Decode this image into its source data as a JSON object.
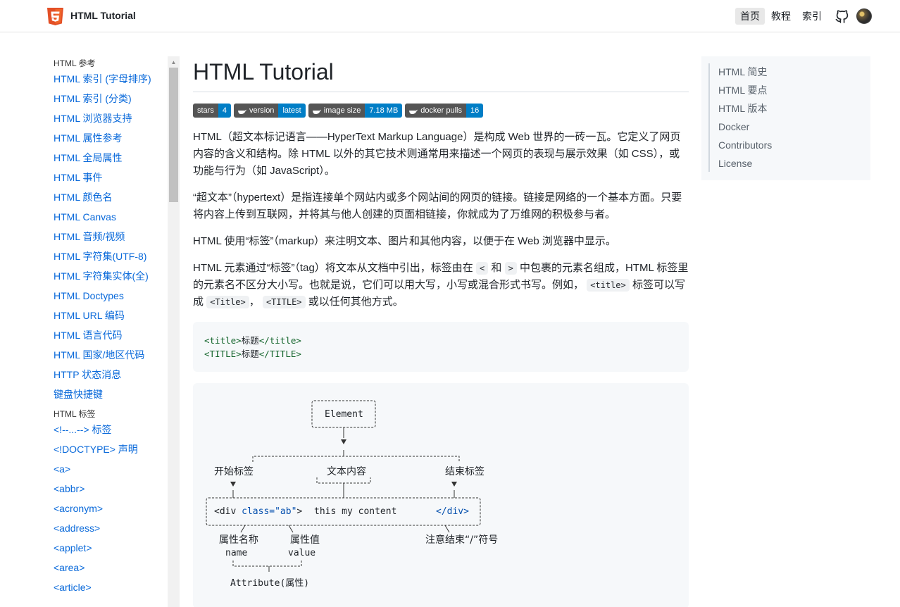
{
  "header": {
    "brand": "HTML Tutorial",
    "nav": [
      "首页",
      "教程",
      "索引"
    ]
  },
  "sidebar": {
    "group1": "HTML 参考",
    "items1": [
      "HTML 索引 (字母排序)",
      "HTML 索引 (分类)",
      "HTML 浏览器支持",
      "HTML 属性参考",
      "HTML 全局属性",
      "HTML 事件",
      "HTML 颜色名",
      "HTML Canvas",
      "HTML 音频/视频",
      "HTML 字符集(UTF-8)",
      "HTML 字符集实体(全)",
      "HTML Doctypes",
      "HTML URL 编码",
      "HTML 语言代码",
      "HTML 国家/地区代码",
      "HTTP 状态消息",
      "键盘快捷键"
    ],
    "group2": "HTML 标签",
    "items2": [
      "<!--...--> 标签",
      "<!DOCTYPE> 声明",
      "<a>",
      "<abbr>",
      "<acronym>",
      "<address>",
      "<applet>",
      "<area>",
      "<article>"
    ]
  },
  "main": {
    "title": "HTML Tutorial",
    "badges": [
      {
        "label": "stars",
        "value": "4",
        "icon": false
      },
      {
        "label": "version",
        "value": "latest",
        "icon": true
      },
      {
        "label": "image size",
        "value": "7.18 MB",
        "icon": true
      },
      {
        "label": "docker pulls",
        "value": "16",
        "icon": true
      }
    ],
    "p1": "HTML（超文本标记语言——HyperText Markup Language）是构成 Web 世界的一砖一瓦。它定义了网页内容的含义和结构。除 HTML 以外的其它技术则通常用来描述一个网页的表现与展示效果（如 CSS），或功能与行为（如 JavaScript）。",
    "p2": "“超文本”（hypertext）是指连接单个网站内或多个网站间的网页的链接。链接是网络的一个基本方面。只要将内容上传到互联网，并将其与他人创建的页面相链接，你就成为了万维网的积极参与者。",
    "p3": "HTML 使用“标签”（markup）来注明文本、图片和其他内容，以便于在 Web 浏览器中显示。",
    "p4": {
      "a": "HTML 元素通过“标签”（tag）将文本从文档中引出，标签由在",
      "lt": "<",
      "and": "和",
      "gt": ">",
      "b": "中包裹的元素名组成，HTML 标签里的元素名不区分大小写。也就是说，它们可以用大写，小写或混合形式书写。例如，",
      "c1": "<title>",
      "c": "标签可以写成",
      "c2": "<Title>",
      "comma": "，",
      "c3": "<TITLE>",
      "d": "或以任何其他方式。"
    },
    "code": {
      "l1_open": "<title>",
      "l1_text": "标题",
      "l1_close": "</title>",
      "l2_open": "<TITLE>",
      "l2_text": "标题",
      "l2_close": "</TITLE>"
    },
    "diagram": {
      "element": "Element",
      "start_tag": "开始标签",
      "content_label": "文本内容",
      "end_tag": "结束标签",
      "div_open": "<div",
      "attr": "class=\"ab\"",
      "gt": ">",
      "content": "this my content",
      "div_close": "</div>",
      "attr_name": "属性名称",
      "attr_value": "属性值",
      "note": "注意结束“/”符号",
      "name": "name",
      "value": "value",
      "attribute": "Attribute(属性)"
    }
  },
  "toc": [
    "HTML 简史",
    "HTML 要点",
    "HTML 版本",
    "Docker",
    "Contributors",
    "License"
  ]
}
